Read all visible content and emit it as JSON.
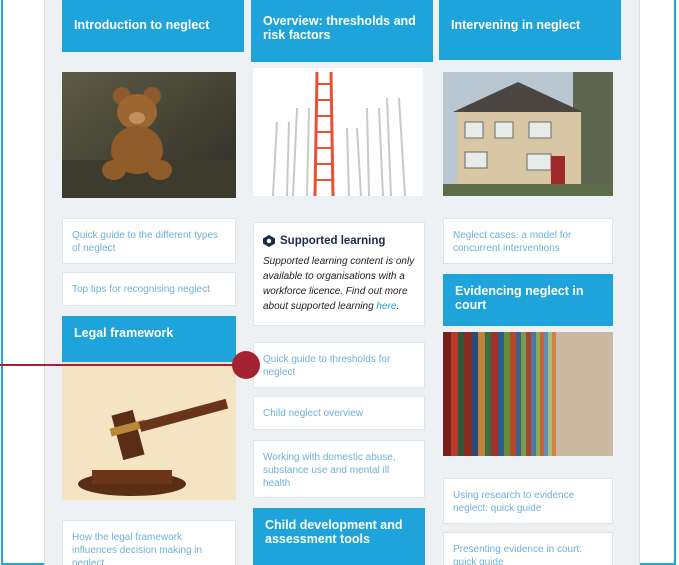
{
  "columns": {
    "intro": {
      "heading": "Introduction to neglect"
    },
    "overview": {
      "heading": "Overview: thresholds and risk factors"
    },
    "intervening": {
      "heading": "Intervening in neglect"
    },
    "legal": {
      "heading": "Legal framework"
    },
    "evidencing": {
      "heading": "Evidencing neglect in court"
    },
    "child_dev": {
      "heading": "Child development and assessment tools"
    }
  },
  "links": {
    "quick_guide_types": "Quick guide to the different types of neglect",
    "top_tips": "Top tips for recognising neglect",
    "legal_influence": "How the legal framework influences decision making in neglect",
    "quick_guide_thresholds": "Quick guide to thresholds for neglect",
    "child_neglect_overview": "Child neglect overview",
    "working_domestic": "Working with domestic abuse, substance use and mental ill health",
    "neglect_cases": "Neglect cases: a model for concurrent interventions",
    "using_research": "Using research to evidence neglect: quick guide",
    "presenting_evidence": "Presenting evidence in court: quick guide"
  },
  "supported": {
    "title": "Supported learning",
    "body": "Supported learning content is only available to organisations with a workforce licence. Find out more about supported learning ",
    "link": "here",
    "end": "."
  },
  "colors": {
    "accent": "#1ea3da",
    "pointer": "#a52233",
    "link": "#6fb1d6"
  },
  "icons": [
    "supported-learning-icon"
  ]
}
